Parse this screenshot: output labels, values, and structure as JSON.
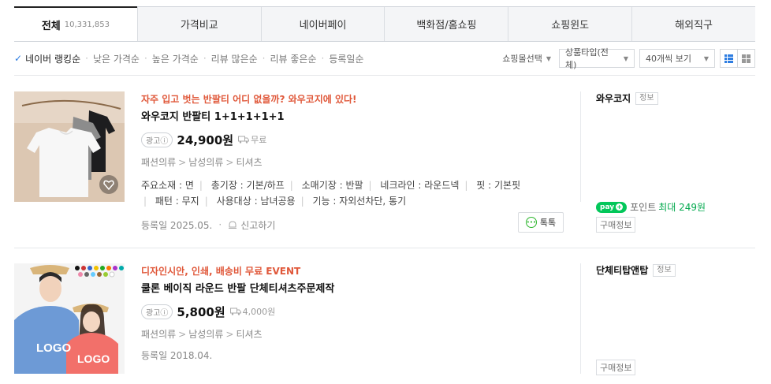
{
  "tabs": [
    {
      "label": "전체",
      "count": "10,331,853"
    },
    {
      "label": "가격비교"
    },
    {
      "label": "네이버페이"
    },
    {
      "label": "백화점/홈쇼핑"
    },
    {
      "label": "쇼핑윈도"
    },
    {
      "label": "해외직구"
    }
  ],
  "sort": {
    "options": [
      "네이버 랭킹순",
      "낮은 가격순",
      "높은 가격순",
      "리뷰 많은순",
      "리뷰 좋은순",
      "등록일순"
    ],
    "mall_select": "쇼핑몰선택",
    "product_type": "상품타입(전체)",
    "per_page": "40개씩 보기"
  },
  "products": [
    {
      "promo": "자주 입고 벗는 반팔티 어디 없을까? 와우코지에 있다!",
      "title": "와우코지 반팔티 1+1+1+1+1",
      "ad": "광고ⓘ",
      "price": "24,900원",
      "shipping": "무료",
      "category": [
        "패션의류",
        "남성의류",
        "티셔츠"
      ],
      "specs_line1": [
        "주요소재 : 면",
        "총기장 : 기본/하프",
        "소매기장 : 반팔",
        "네크라인 : 라운드넥",
        "핏 : 기본핏"
      ],
      "specs_line2": [
        "패턴 : 무지",
        "사용대상 : 남녀공용",
        "기능 : 자외선차단, 통기"
      ],
      "registered": "등록일 2025.05.",
      "report": "신고하기",
      "talk": "톡톡",
      "seller": "와우코지",
      "seller_info": "정보",
      "npay_label": "pay",
      "point_label": "포인트",
      "point_max": "최대 249원",
      "buy_info": "구매정보"
    },
    {
      "promo": "디자인시안, 인쇄, 배송비 무료 EVENT",
      "title": "쿨론 베이직 라운드 반팔 단체티셔츠주문제작",
      "ad": "광고ⓘ",
      "price": "5,800원",
      "shipping": "4,000원",
      "category": [
        "패션의류",
        "남성의류",
        "티셔츠"
      ],
      "registered": "등록일 2018.04.",
      "seller": "단체티탑앤탑",
      "seller_info": "정보",
      "buy_info": "구매정보",
      "logo_text": "LOGO"
    }
  ],
  "colors": {
    "promo": "#e0583a",
    "npay_green": "#03c75a",
    "accent_blue": "#2e7de1"
  },
  "icons": [
    "check-icon",
    "truck-icon",
    "bell-icon",
    "talk-icon",
    "heart-icon",
    "list-view-icon",
    "grid-view-icon"
  ]
}
